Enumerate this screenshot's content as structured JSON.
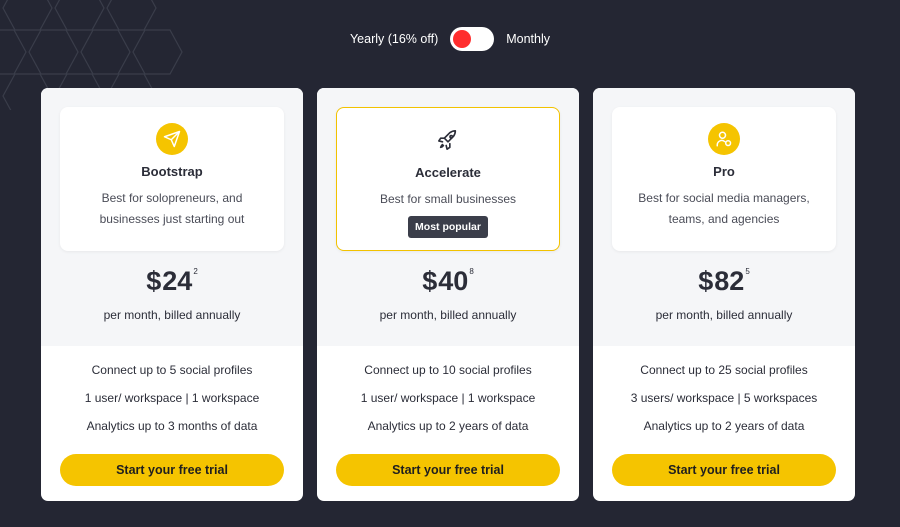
{
  "billing_toggle": {
    "yearly_label": "Yearly (16% off)",
    "monthly_label": "Monthly"
  },
  "plans": [
    {
      "name": "Bootstrap",
      "icon": "paper-plane-icon",
      "description": "Best for solopreneurs, and businesses just starting out",
      "currency": "$",
      "price": "24",
      "price_sup": "2",
      "billing_note": "per month, billed annually",
      "features": [
        "Connect up to 5 social profiles",
        "1 user/ workspace | 1 workspace",
        "Analytics up to 3 months of data"
      ],
      "cta": "Start your free trial"
    },
    {
      "name": "Accelerate",
      "icon": "rocket-icon",
      "description": "Best for small businesses",
      "badge": "Most popular",
      "currency": "$",
      "price": "40",
      "price_sup": "8",
      "billing_note": "per month, billed annually",
      "features": [
        "Connect up to 10 social profiles",
        "1 user/ workspace | 1 workspace",
        "Analytics up to 2 years of data"
      ],
      "cta": "Start your free trial"
    },
    {
      "name": "Pro",
      "icon": "users-icon",
      "description": "Best for social media managers, teams, and agencies",
      "currency": "$",
      "price": "82",
      "price_sup": "5",
      "billing_note": "per month, billed annually",
      "features": [
        "Connect up to 25 social profiles",
        "3 users/ workspace | 5 workspaces",
        "Analytics up to 2 years of data"
      ],
      "cta": "Start your free trial"
    }
  ],
  "colors": {
    "background": "#242633",
    "accent": "#f5c400",
    "toggle_knob": "#ff2d2d",
    "badge": "#3b3e4a"
  }
}
